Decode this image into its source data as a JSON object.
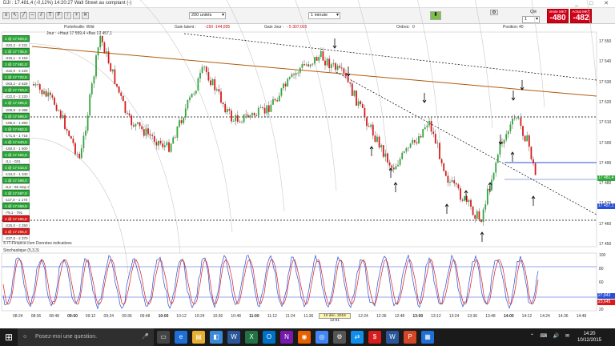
{
  "window": {
    "title": "DJI : 17.481,4 (-0,12%) 14:20:27 Wall Street au comptant (-)",
    "controls": [
      "_",
      "□",
      "✕"
    ]
  },
  "toolbar": {
    "units_select": "200 unités",
    "interval_select": "1 minute",
    "qte_label": "Qté",
    "qte_value": "1",
    "sell": {
      "label": "Vente MKT",
      "value": "-480"
    },
    "buy": {
      "label": "Achat MKT",
      "value": "-482"
    },
    "colors": {
      "sell": "#d0021b",
      "buy": "#d0021b",
      "up_candle": "#2fa83a",
      "down_candle": "#d81b1b"
    }
  },
  "info": {
    "portfolio": "Portefeuille: Wild",
    "gain_latent": "Gain latent :",
    "gain_latent_value": "-150 -144,005",
    "gain_jour": "Gain Jour :",
    "gain_jour_value": "- 5 307,005",
    "ordres": "Ordres:",
    "ordres_value": "0",
    "position": "Position:",
    "position_value": "40",
    "chart_header": "Jour : +Haut 17 559,4 +Bas 17 457,1"
  },
  "price_axis": [
    "17 550",
    "17 540",
    "17 530",
    "17 520",
    "17 510",
    "17 500",
    "17 490",
    "17 480",
    "17 470",
    "17 460",
    "17 450"
  ],
  "price_tags": [
    {
      "text": "17 481,4",
      "color": "#2fa83a"
    },
    {
      "text": "17 457,1",
      "color": "#2a4fd6"
    }
  ],
  "orders": [
    {
      "text": "1 @ 17 600,5",
      "style": "green"
    },
    {
      "text": "-222,2  - 2 221",
      "style": "white"
    },
    {
      "text": "1 @ 17 736,5",
      "style": "green"
    },
    {
      "text": "-315,1  - 3 153",
      "style": "white"
    },
    {
      "text": "1 @ 17 581,0",
      "style": "green"
    },
    {
      "text": "-222,0  - 2 220",
      "style": "white"
    },
    {
      "text": "1 @ 17 722,5",
      "style": "green"
    },
    {
      "text": "-263,2  - 2 629",
      "style": "white"
    },
    {
      "text": "1 @ 17 703,0",
      "style": "green"
    },
    {
      "text": "-222,0  - 2 220 suiveur",
      "style": "white"
    },
    {
      "text": "1 @ 17 695,5",
      "style": "green"
    },
    {
      "text": "-208,9  - 2 086",
      "style": "white"
    },
    {
      "text": "1 @ 17 666,5",
      "style": "green"
    },
    {
      "text": "-185,0  - 1 850",
      "style": "white"
    },
    {
      "text": "1 @ 17 652,5",
      "style": "green"
    },
    {
      "text": "-171,5  - 1 715",
      "style": "white"
    },
    {
      "text": "1 @ 17 640,5",
      "style": "green"
    },
    {
      "text": "-160,0  - 1 600",
      "style": "white"
    },
    {
      "text": "1 @ 17 484,5",
      "style": "green"
    },
    {
      "text": "-3,1  - 031",
      "style": "white"
    },
    {
      "text": "1 @ 17 615,5",
      "style": "green"
    },
    {
      "text": "-134,0  - 1 340",
      "style": "white"
    },
    {
      "text": "1 @ 17 488,0",
      "style": "green"
    },
    {
      "text": "-6,6  - 66 stop suiveur",
      "style": "white"
    },
    {
      "text": "1 @ 17 597,0",
      "style": "green"
    },
    {
      "text": "-117,0  - 1 170",
      "style": "white"
    },
    {
      "text": "1 @ 17 559,5",
      "style": "green"
    },
    {
      "text": "-79,1  - 791",
      "style": "white"
    },
    {
      "text": "1 @ 17 266,5",
      "style": "red"
    },
    {
      "text": "-225,0  - 2 250",
      "style": "white"
    },
    {
      "text": "1 @ 17 255,0",
      "style": "red"
    },
    {
      "text": "-237,0  - 2 370",
      "style": "white"
    }
  ],
  "copyright": "© IT-Finance.com Données indicatives",
  "stochastic": {
    "label": "Stochastique (5,3,3)",
    "axis": [
      "100",
      "80",
      "60",
      "40",
      "20"
    ],
    "tag1": "27,843",
    "tag2": "23,645"
  },
  "time_axis": [
    {
      "label": "08:24"
    },
    {
      "label": "08:36"
    },
    {
      "label": "08:48"
    },
    {
      "label": "09:00",
      "bold": true
    },
    {
      "label": "09:12"
    },
    {
      "label": "09:24"
    },
    {
      "label": "09:36"
    },
    {
      "label": "09:48"
    },
    {
      "label": "10:00",
      "bold": true
    },
    {
      "label": "10:12"
    },
    {
      "label": "10:24"
    },
    {
      "label": "10:36"
    },
    {
      "label": "10:48"
    },
    {
      "label": "11:00",
      "bold": true
    },
    {
      "label": "11:12"
    },
    {
      "label": "11:24"
    },
    {
      "label": "11:36"
    },
    {
      "label": "12:00"
    },
    {
      "label": "12:12"
    },
    {
      "label": "12:24"
    },
    {
      "label": "12:36"
    },
    {
      "label": "12:48"
    },
    {
      "label": "13:00",
      "bold": true
    },
    {
      "label": "13:12"
    },
    {
      "label": "13:24"
    },
    {
      "label": "13:36"
    },
    {
      "label": "13:48"
    },
    {
      "label": "14:00",
      "bold": true
    },
    {
      "label": "14:12"
    },
    {
      "label": "14:24"
    },
    {
      "label": "14:36"
    },
    {
      "label": "14:48"
    }
  ],
  "date_marker": "10 déc. 2015 12:01",
  "taskbar": {
    "search_placeholder": "Posez-moi une question.",
    "time": "14:20",
    "date": "10/12/2015",
    "apps": [
      "task-view",
      "edge",
      "explorer",
      "store",
      "word",
      "excel",
      "outlook",
      "onenote",
      "firefox",
      "chrome",
      "settings",
      "teamviewer",
      "trading-app",
      "word2",
      "powerpoint",
      "photos"
    ]
  }
}
